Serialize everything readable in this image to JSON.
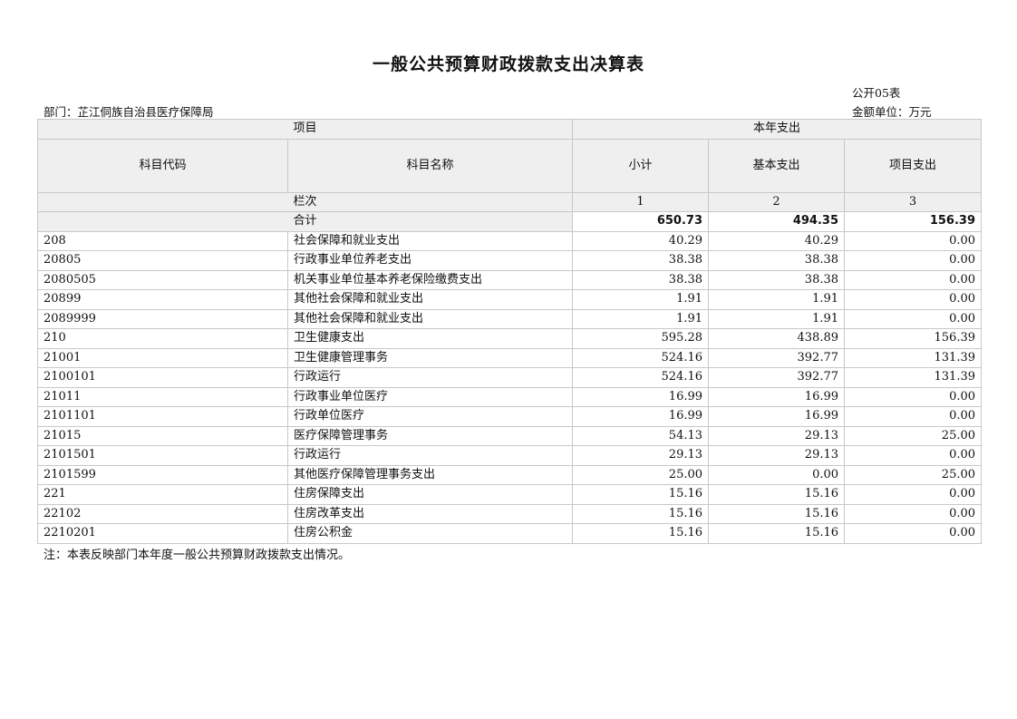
{
  "title": "一般公共预算财政拨款支出决算表",
  "form_no": "公开05表",
  "department": "部门：芷江侗族自治县医疗保障局",
  "unit": "金额单位：万元",
  "header": {
    "item": "项目",
    "current_year": "本年支出",
    "code": "科目代码",
    "name": "科目名称",
    "subtotal": "小计",
    "basic": "基本支出",
    "project": "项目支出",
    "column_label": "栏次",
    "col1": "1",
    "col2": "2",
    "col3": "3"
  },
  "total": {
    "label": "合计",
    "subtotal": "650.73",
    "basic": "494.35",
    "project": "156.39"
  },
  "rows": [
    {
      "code": "208",
      "name": "社会保障和就业支出",
      "subtotal": "40.29",
      "basic": "40.29",
      "project": "0.00"
    },
    {
      "code": "20805",
      "name": "行政事业单位养老支出",
      "subtotal": "38.38",
      "basic": "38.38",
      "project": "0.00"
    },
    {
      "code": "2080505",
      "name": "机关事业单位基本养老保险缴费支出",
      "subtotal": "38.38",
      "basic": "38.38",
      "project": "0.00"
    },
    {
      "code": "20899",
      "name": "其他社会保障和就业支出",
      "subtotal": "1.91",
      "basic": "1.91",
      "project": "0.00"
    },
    {
      "code": "2089999",
      "name": "其他社会保障和就业支出",
      "subtotal": "1.91",
      "basic": "1.91",
      "project": "0.00"
    },
    {
      "code": "210",
      "name": "卫生健康支出",
      "subtotal": "595.28",
      "basic": "438.89",
      "project": "156.39"
    },
    {
      "code": "21001",
      "name": "卫生健康管理事务",
      "subtotal": "524.16",
      "basic": "392.77",
      "project": "131.39"
    },
    {
      "code": "2100101",
      "name": "行政运行",
      "subtotal": "524.16",
      "basic": "392.77",
      "project": "131.39"
    },
    {
      "code": "21011",
      "name": "行政事业单位医疗",
      "subtotal": "16.99",
      "basic": "16.99",
      "project": "0.00"
    },
    {
      "code": "2101101",
      "name": "行政单位医疗",
      "subtotal": "16.99",
      "basic": "16.99",
      "project": "0.00"
    },
    {
      "code": "21015",
      "name": "医疗保障管理事务",
      "subtotal": "54.13",
      "basic": "29.13",
      "project": "25.00"
    },
    {
      "code": "2101501",
      "name": "行政运行",
      "subtotal": "29.13",
      "basic": "29.13",
      "project": "0.00"
    },
    {
      "code": "2101599",
      "name": "其他医疗保障管理事务支出",
      "subtotal": "25.00",
      "basic": "0.00",
      "project": "25.00"
    },
    {
      "code": "221",
      "name": "住房保障支出",
      "subtotal": "15.16",
      "basic": "15.16",
      "project": "0.00"
    },
    {
      "code": "22102",
      "name": "住房改革支出",
      "subtotal": "15.16",
      "basic": "15.16",
      "project": "0.00"
    },
    {
      "code": "2210201",
      "name": "住房公积金",
      "subtotal": "15.16",
      "basic": "15.16",
      "project": "0.00"
    }
  ],
  "note": "注：本表反映部门本年度一般公共预算财政拨款支出情况。"
}
